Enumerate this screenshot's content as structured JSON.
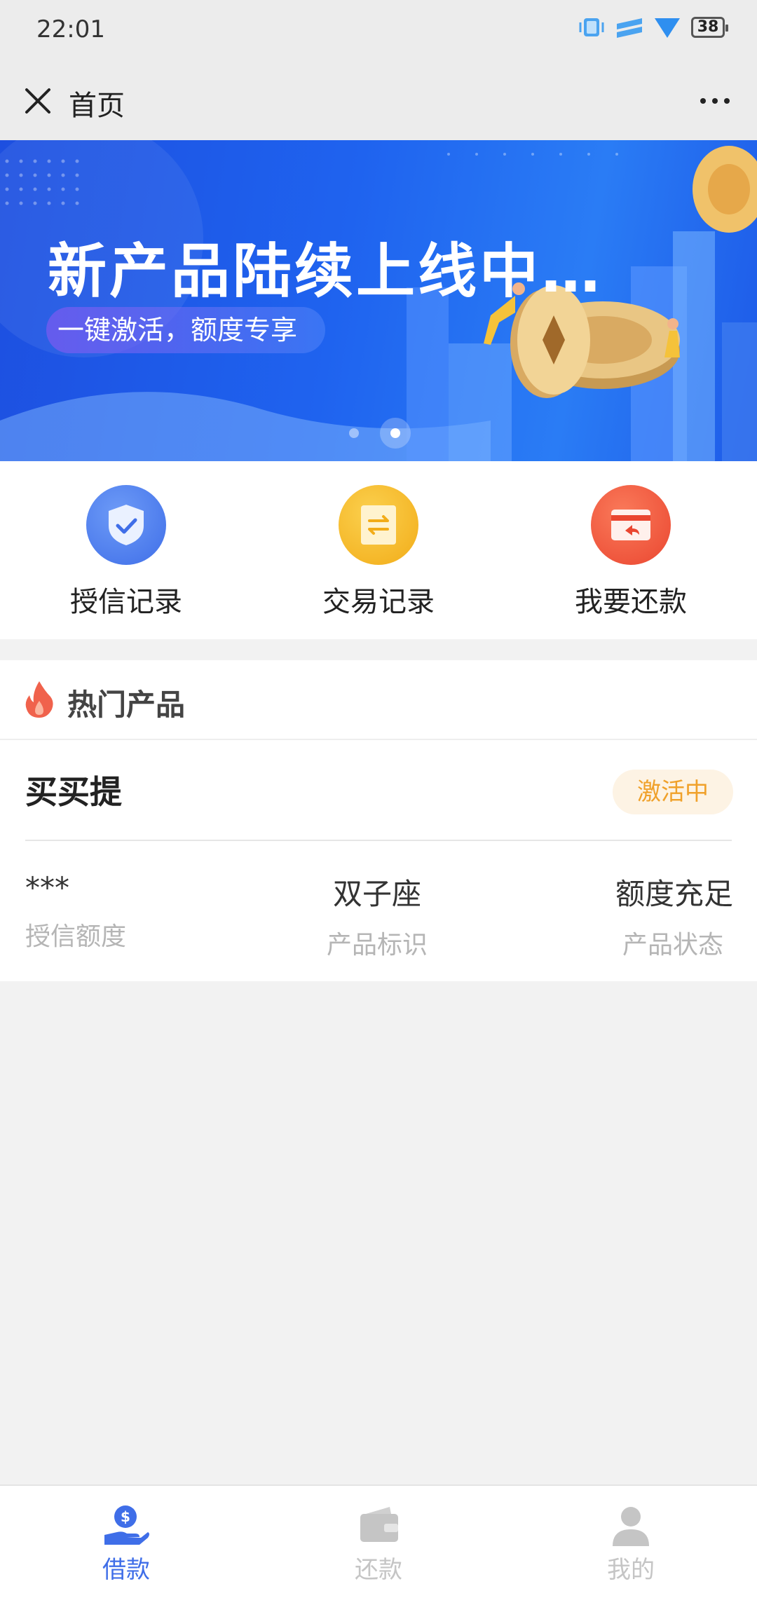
{
  "status_bar": {
    "time": "22:01",
    "battery": "38"
  },
  "nav": {
    "title": "首页"
  },
  "banner": {
    "title": "新产品陆续上线中…",
    "subtitle": "一键激活，额度专享",
    "page_count": 2,
    "active_page": 2
  },
  "quick_actions": [
    {
      "label": "授信记录",
      "icon": "shield-check-icon",
      "color": "#4a7ef0"
    },
    {
      "label": "交易记录",
      "icon": "exchange-icon",
      "color": "#f5b526"
    },
    {
      "label": "我要还款",
      "icon": "wallet-return-icon",
      "color": "#f0553a"
    }
  ],
  "hot_products": {
    "title": "热门产品",
    "product": {
      "name": "买买提",
      "status_badge": "激活中",
      "stats": [
        {
          "value": "***",
          "label": "授信额度"
        },
        {
          "value": "双子座",
          "label": "产品标识"
        },
        {
          "value": "额度充足",
          "label": "产品状态"
        }
      ]
    }
  },
  "tabs": [
    {
      "label": "借款",
      "icon": "loan-hand-icon",
      "active": true
    },
    {
      "label": "还款",
      "icon": "wallet-icon",
      "active": false
    },
    {
      "label": "我的",
      "icon": "user-icon",
      "active": false
    }
  ],
  "colors": {
    "accent": "#3f6ee8",
    "inactive": "#c5c5c5",
    "badge_text": "#f0a12a",
    "badge_bg": "#fdf3e4"
  }
}
